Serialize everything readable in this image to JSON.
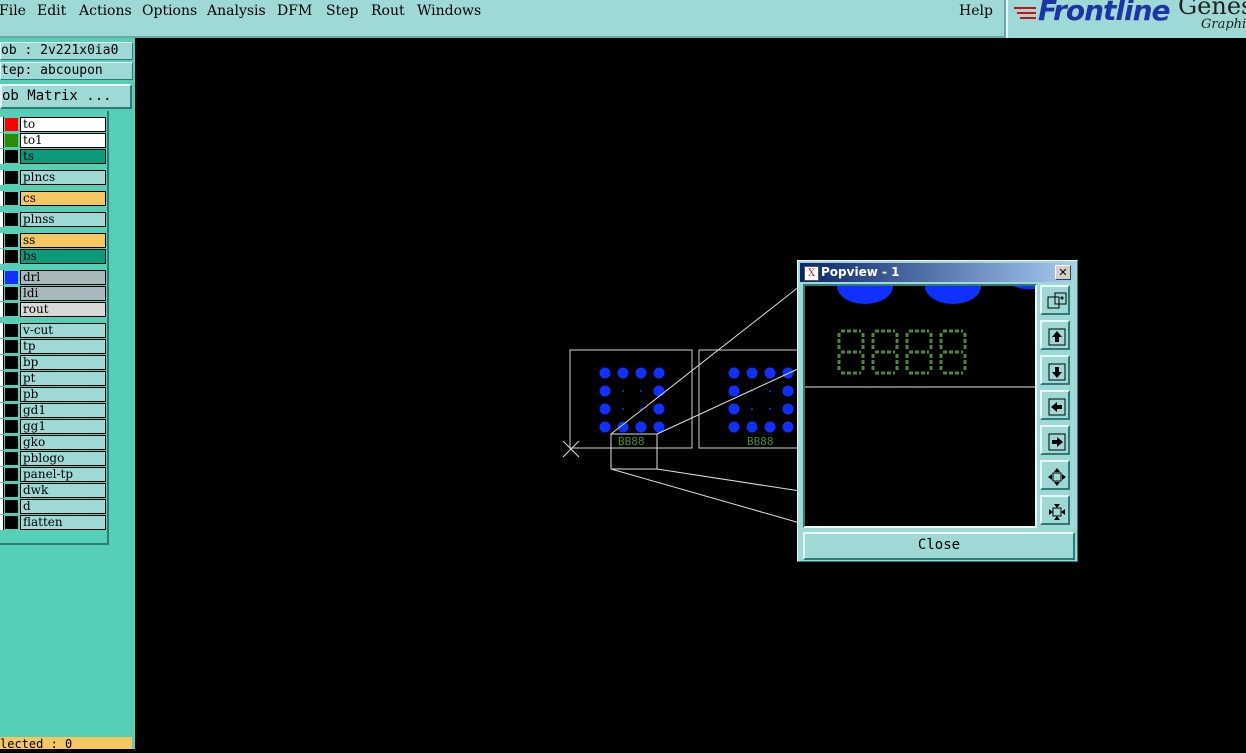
{
  "menubar": {
    "items": [
      "File",
      "Edit",
      "Actions",
      "Options",
      "Analysis",
      "DFM",
      "Step",
      "Rout",
      "Windows"
    ],
    "help": "Help"
  },
  "logo": {
    "brand": "Frontline",
    "product": "Genesi",
    "subtitle": "Graphic"
  },
  "panel": {
    "job": "ob : 2v221x0ia0",
    "step": "tep: abcoupon",
    "matrix_button": "ob Matrix ...",
    "selected": "lected : 0"
  },
  "layers": [
    {
      "name": "to",
      "bg": "#ffffff",
      "swatch": "#ff0000"
    },
    {
      "name": "to1",
      "bg": "#ffffff",
      "swatch": "#2e8b00"
    },
    {
      "name": "ts",
      "bg": "#0d9a7a",
      "swatch": "#000000"
    },
    {
      "name": "plncs",
      "bg": "#9fd9d6",
      "swatch": "#000000"
    },
    {
      "name": "cs",
      "bg": "#f6c760",
      "swatch": "#000000"
    },
    {
      "name": "plnss",
      "bg": "#9fd9d6",
      "swatch": "#000000"
    },
    {
      "name": "ss",
      "bg": "#f6c760",
      "swatch": "#000000"
    },
    {
      "name": "bs",
      "bg": "#0d9a7a",
      "swatch": "#000000"
    },
    {
      "name": "drl",
      "bg": "#a8b8bc",
      "swatch": "#1030ff"
    },
    {
      "name": "ldi",
      "bg": "#a8b8bc",
      "swatch": "#000000"
    },
    {
      "name": "rout",
      "bg": "#d8d8d8",
      "swatch": "#000000"
    },
    {
      "name": "v-cut",
      "bg": "#9fd9d6",
      "swatch": "#000000"
    },
    {
      "name": "tp",
      "bg": "#9fd9d6",
      "swatch": "#000000"
    },
    {
      "name": "bp",
      "bg": "#9fd9d6",
      "swatch": "#000000"
    },
    {
      "name": "pt",
      "bg": "#9fd9d6",
      "swatch": "#000000"
    },
    {
      "name": "pb",
      "bg": "#9fd9d6",
      "swatch": "#000000"
    },
    {
      "name": "gd1",
      "bg": "#9fd9d6",
      "swatch": "#000000"
    },
    {
      "name": "gg1",
      "bg": "#9fd9d6",
      "swatch": "#000000"
    },
    {
      "name": "gko",
      "bg": "#9fd9d6",
      "swatch": "#000000"
    },
    {
      "name": "pblogo",
      "bg": "#9fd9d6",
      "swatch": "#000000"
    },
    {
      "name": "panel-tp",
      "bg": "#9fd9d6",
      "swatch": "#000000"
    },
    {
      "name": "dwk",
      "bg": "#9fd9d6",
      "swatch": "#000000"
    },
    {
      "name": "d",
      "bg": "#9fd9d6",
      "swatch": "#000000"
    },
    {
      "name": "flatten",
      "bg": "#9fd9d6",
      "swatch": "#000000"
    }
  ],
  "canvas": {
    "board_label_1": "BB88",
    "board_label_2": "BB88",
    "pad_color": "#1030ff",
    "text_color": "#4a8a30"
  },
  "popview": {
    "title": "Popview - 1",
    "close_label": "Close",
    "digits": "8888",
    "tools": [
      "zoom-box-icon",
      "pan-up-icon",
      "pan-down-icon",
      "pan-left-icon",
      "pan-right-icon",
      "zoom-in-icon",
      "zoom-fit-icon"
    ]
  }
}
